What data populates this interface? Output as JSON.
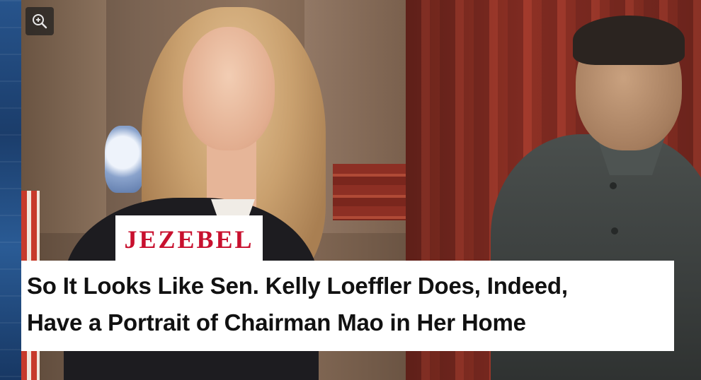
{
  "viewer": {
    "zoom_icon": "zoom-in-icon"
  },
  "article": {
    "brand": "JEZEBEL",
    "headline_line1": "So It Looks Like Sen. Kelly Loeffler Does, Indeed,",
    "headline_line2": "Have a Portrait of Chairman Mao in Her Home"
  },
  "colors": {
    "brand_red": "#c8102e",
    "headline_text": "#111111",
    "overlay_bg": "#ffffff"
  }
}
